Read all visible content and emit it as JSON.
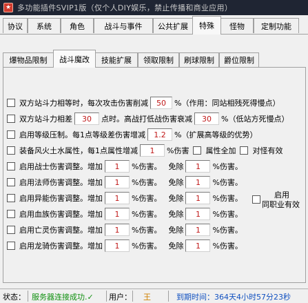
{
  "window": {
    "title": "多功能插件SVIP1版（仅个人DIY娱乐，禁止传播和商业应用）",
    "icon": "app-icon"
  },
  "tabs": [
    {
      "label": "协议"
    },
    {
      "label": "系统"
    },
    {
      "label": "角色"
    },
    {
      "label": "战斗与事件"
    },
    {
      "label": "公共扩展"
    },
    {
      "label": "特殊"
    },
    {
      "label": "怪物"
    },
    {
      "label": "定制功能"
    }
  ],
  "active_tab": "特殊",
  "subtabs": [
    {
      "label": "爆物品限制"
    },
    {
      "label": "战斗魔改"
    },
    {
      "label": "技能扩展"
    },
    {
      "label": "领取限制"
    },
    {
      "label": "刷球限制"
    },
    {
      "label": "爵位限制"
    }
  ],
  "active_subtab": "战斗魔改",
  "rows": {
    "r1": {
      "pre": "双方站斗力相等时，每次攻击伤害削减",
      "value": "50",
      "post": "%（作用：同站相残死得慢点）"
    },
    "r2": {
      "pre": "双方站斗力相差",
      "value": "30",
      "mid": "点时。高战打低战伤害衰减",
      "value2": "30",
      "post": "%（低站方死慢点）"
    },
    "r3": {
      "pre": "启用等级压制。每1点等级差伤害增减",
      "value": "1.2",
      "post": "%（扩展高等级的优势）"
    },
    "r4": {
      "pre": "装备风火土水属性，每1点属性增减",
      "value": "1",
      "post": "%伤害",
      "opt1": "属性全加",
      "opt2": "对怪有效"
    },
    "dmg": [
      {
        "label": "启用战士伤害调整。增加",
        "add": "1",
        "add_unit": "%伤害。",
        "red_label": "免除",
        "red": "1",
        "red_unit": "%伤害。"
      },
      {
        "label": "启用法师伤害调整。增加",
        "add": "1",
        "add_unit": "%伤害。",
        "red_label": "免除",
        "red": "1",
        "red_unit": "%伤害。"
      },
      {
        "label": "启用异能伤害调整。增加",
        "add": "1",
        "add_unit": "%伤害。",
        "red_label": "免除",
        "red": "1",
        "red_unit": "%伤害。"
      },
      {
        "label": "启用血族伤害调整。增加",
        "add": "1",
        "add_unit": "%伤害。",
        "red_label": "免除",
        "red": "1",
        "red_unit": "%伤害。"
      },
      {
        "label": "启用亡灵伤害调整。增加",
        "add": "1",
        "add_unit": "%伤害。",
        "red_label": "免除",
        "red": "1",
        "red_unit": "%伤害。"
      },
      {
        "label": "启用龙骑伤害调整。增加",
        "add": "1",
        "add_unit": "%伤害。",
        "red_label": "免除",
        "red": "1",
        "red_unit": "%伤害。"
      }
    ],
    "side": {
      "line1": "启用",
      "line2": "同职业有效"
    }
  },
  "status": {
    "label": "状态：",
    "conn": "服务器连接成功.✓",
    "user_label": "用户：",
    "user": "王",
    "expire": "到期时间：364天4小时57分23秒"
  },
  "colors": {
    "value_text": "#c01818",
    "status_ok": "#109010",
    "user": "#d08000",
    "expire": "#1050c0"
  }
}
